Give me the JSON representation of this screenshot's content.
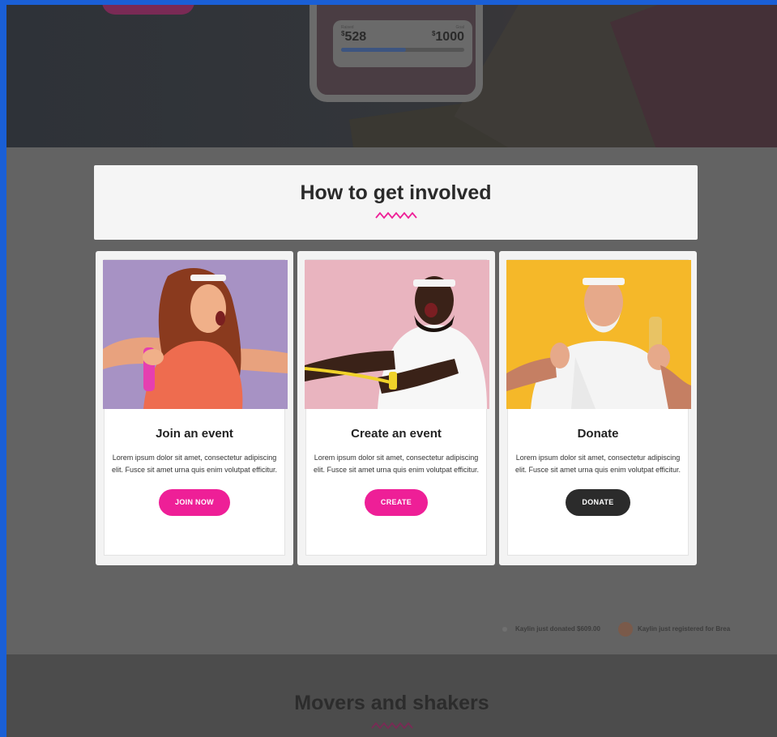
{
  "colors": {
    "accent": "#ee1f97",
    "dark_button": "#2b2b2b",
    "page_frame": "#1a5fd6"
  },
  "hero": {
    "phone": {
      "raised_label": "Raised",
      "goal_label": "Goal",
      "raised_currency": "$",
      "raised_value": "528",
      "goal_currency": "$",
      "goal_value": "1000",
      "progress_fraction": 0.528
    }
  },
  "involved": {
    "title": "How to get involved",
    "cards": [
      {
        "title": "Join an event",
        "description": "Lorem ipsum dolor sit amet, consectetur adipiscing elit. Fusce sit amet urna quis enim volutpat efficitur.",
        "button": "JOIN NOW"
      },
      {
        "title": "Create an event",
        "description": "Lorem ipsum dolor sit amet, consectetur adipiscing elit. Fusce sit amet urna quis enim volutpat efficitur.",
        "button": "CREATE"
      },
      {
        "title": "Donate",
        "description": "Lorem ipsum dolor sit amet, consectetur adipiscing elit. Fusce sit amet urna quis enim volutpat efficitur.",
        "button": "DONATE"
      }
    ]
  },
  "ticker": {
    "item1": "Kaylin just donated $609.00",
    "item2": "Kaylin just registered for Brea"
  },
  "movers": {
    "title": "Movers and shakers"
  }
}
